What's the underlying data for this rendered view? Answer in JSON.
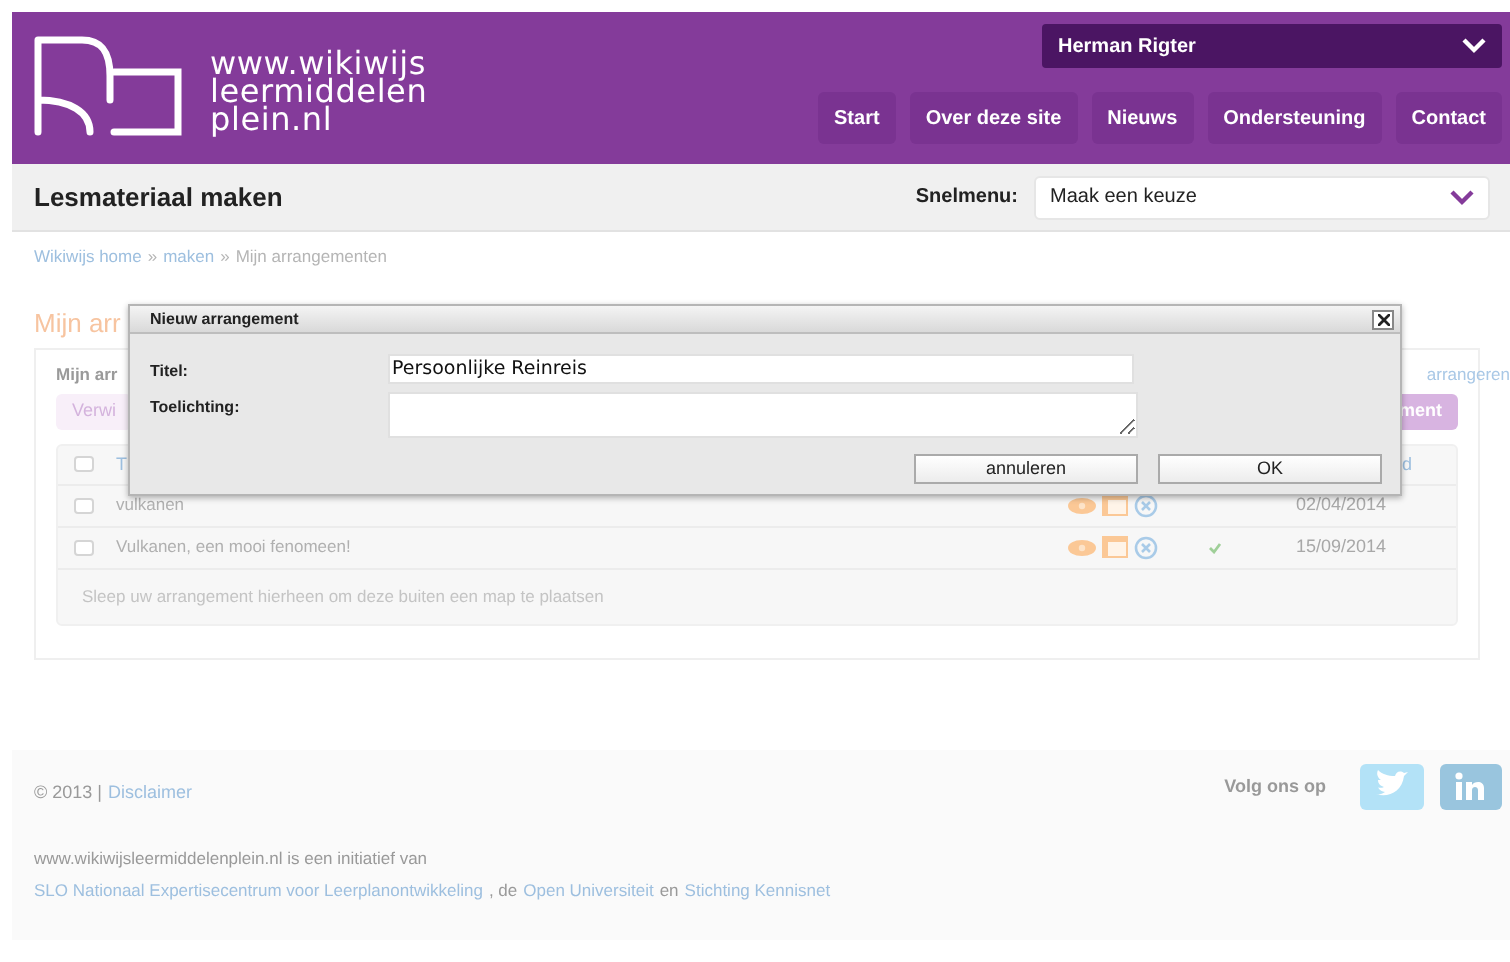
{
  "header": {
    "logo_lines": [
      "www.wikiwijs",
      "leermiddelen",
      "plein.nl"
    ],
    "user_menu": "Herman Rigter",
    "nav": [
      "Start",
      "Over deze site",
      "Nieuws",
      "Ondersteuning",
      "Contact"
    ]
  },
  "subbar": {
    "title": "Lesmateriaal maken",
    "quick_menu_label": "Snelmenu:",
    "quick_menu_value": "Maak een keuze"
  },
  "breadcrumb": [
    {
      "label": "Wikiwijs home",
      "kind": "link"
    },
    {
      "label": "»",
      "kind": "text"
    },
    {
      "label": "maken",
      "kind": "link"
    },
    {
      "label": "»",
      "kind": "text"
    },
    {
      "label": "Mijn arrangementen",
      "kind": "text"
    }
  ],
  "page_heading": "Mijn arr",
  "panel": {
    "tab": "Mijn arr",
    "side_link": "arrangeren",
    "buttons": [
      {
        "label": "Verwi",
        "kind": "soft"
      },
      {
        "label": "ment",
        "kind": "primary"
      }
    ],
    "table": {
      "columns": [
        "T",
        "d"
      ],
      "select_all_checked": false,
      "rows": [
        {
          "title": "vulkanen",
          "checked": false,
          "published": false,
          "date": "02/04/2014"
        },
        {
          "title": "Vulkanen, een mooi fenomeen!",
          "checked": false,
          "published": true,
          "date": "15/09/2014"
        }
      ],
      "drop_hint": "Sleep uw arrangement hierheen om deze buiten een map te plaatsen"
    }
  },
  "dialog": {
    "title": "Nieuw arrangement",
    "fields": [
      {
        "label": "Titel:",
        "value": "Persoonlijke Reinreis",
        "kind": "input"
      },
      {
        "label": "Toelichting:",
        "kind": "textarea"
      }
    ],
    "buttons": [
      "annuleren",
      "OK"
    ]
  },
  "footer": {
    "copyright": "© 2013 |",
    "disclaimer": "Disclaimer",
    "follow": "Volg ons op",
    "initiative": "www.wikiwijsleermiddelenplein.nl is een initiatief van",
    "partners": [
      {
        "text": "SLO Nationaal Expertisecentrum voor Leerplanontwikkeling",
        "kind": "link"
      },
      {
        "text": ", de",
        "kind": "text"
      },
      {
        "text": "Open Universiteit",
        "kind": "link"
      },
      {
        "text": "en",
        "kind": "text"
      },
      {
        "text": "Stichting Kennisnet",
        "kind": "link"
      }
    ]
  }
}
